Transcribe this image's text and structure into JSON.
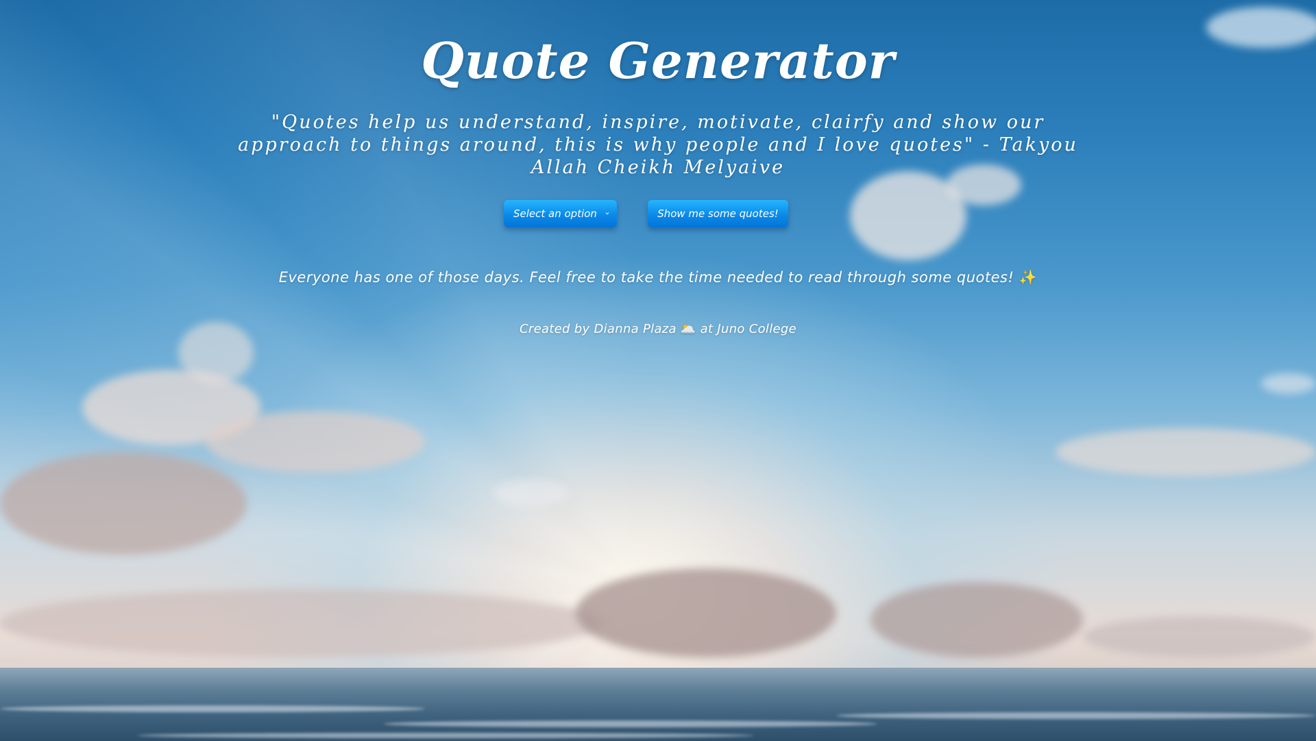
{
  "header": {
    "title": "Quote Generator",
    "subtitle": "\"Quotes help us understand, inspire, motivate, clairfy and show our approach to things around, this is why people and I love quotes\" - Takyou Allah Cheikh Melyaive"
  },
  "controls": {
    "select_value": "Select an option",
    "button_label": "Show me some quotes!"
  },
  "message": {
    "text": "Everyone has one of those days. Feel free to take the time needed to read through some quotes!",
    "emoji": "✨"
  },
  "credit": {
    "prefix": "Created by Dianna Plaza",
    "emoji": "🌥️",
    "suffix": "at Juno College"
  },
  "colors": {
    "button_top": "#27b4ff",
    "button_bottom": "#0574d8",
    "sky_top": "#1d6ca8",
    "text": "#ffffff"
  }
}
